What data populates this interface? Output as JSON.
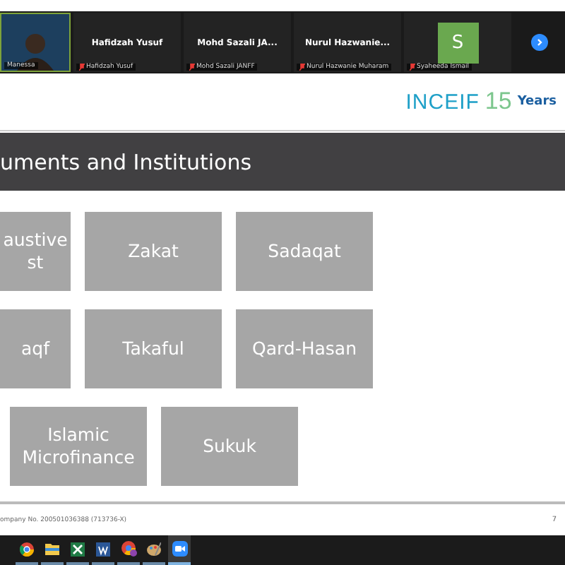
{
  "gallery": {
    "tiles": [
      {
        "kind": "video",
        "caption": "Manessa",
        "muted": false
      },
      {
        "kind": "name",
        "title": "Hafidzah Yusuf",
        "caption": "Hafidzah Yusuf",
        "muted": true
      },
      {
        "kind": "name",
        "title": "Mohd Sazali JA...",
        "caption": "Mohd Sazali JANFF",
        "muted": true
      },
      {
        "kind": "name",
        "title": "Nurul Hazwanie...",
        "caption": "Nurul Hazwanie Muharam",
        "muted": true
      },
      {
        "kind": "avatar",
        "initial": "S",
        "caption": "Syaheeda Ismail",
        "muted": true,
        "color": "#6aa84f"
      }
    ]
  },
  "slide": {
    "logo": {
      "brand": "INCEIF",
      "years_number": "15",
      "years_word": "Years"
    },
    "title": "uments and Institutions",
    "rows": [
      [
        {
          "lines": [
            "austive",
            "st"
          ]
        },
        {
          "lines": [
            "Zakat"
          ]
        },
        {
          "lines": [
            "Sadaqat"
          ]
        }
      ],
      [
        {
          "lines": [
            "aqf"
          ]
        },
        {
          "lines": [
            "Takaful"
          ]
        },
        {
          "lines": [
            "Qard-Hasan"
          ]
        }
      ],
      [
        {
          "lines": [
            "Islamic",
            "Microfinance"
          ]
        },
        {
          "lines": [
            "Sukuk"
          ]
        }
      ]
    ],
    "footer": "ompany No. 200501036388 (713736-X)",
    "page_number": "7"
  },
  "taskbar": {
    "icons": [
      {
        "kind": "browser",
        "active": false
      },
      {
        "kind": "folder",
        "active": false
      },
      {
        "kind": "sheet",
        "active": false
      },
      {
        "kind": "doc",
        "active": false
      },
      {
        "kind": "browser2",
        "active": false
      },
      {
        "kind": "paint",
        "active": false
      },
      {
        "kind": "video",
        "active": true
      }
    ]
  }
}
